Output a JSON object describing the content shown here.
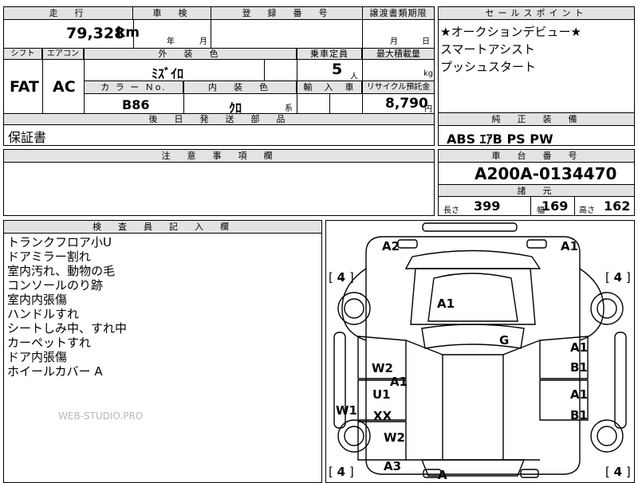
{
  "top_table": {
    "mileage_label": "走　行",
    "mileage_value": "79,328",
    "mileage_unit": "km",
    "inspection_label": "車　検",
    "inspection_year": "年",
    "inspection_month": "月",
    "registration_label": "登　録　番　号",
    "transfer_label": "譲渡書類期限",
    "transfer_month": "月",
    "transfer_day": "日",
    "shift_label": "シフト",
    "aircon_label": "エアコン",
    "exterior_color_label": "外　装　色",
    "seats_label": "乗車定員",
    "max_load_label": "最大積載量",
    "shift_value": "FAT",
    "aircon_value": "AC",
    "exterior_color_value": "ﾐｽﾞｲﾛ",
    "seats_value": "5",
    "seats_unit": "人",
    "max_load_unit": "kg",
    "color_no_label": "カ ラ ー Ｎo.",
    "interior_color_label": "内　装　色",
    "import_label": "輸　入　車",
    "recycle_label": "リサイクル預託金",
    "color_no_value": "B86",
    "interior_color_value": "ｸﾛ",
    "interior_color_suffix": "系",
    "recycle_value": "8,790",
    "recycle_unit": "円",
    "later_parts_label": "後　日　発　送　部　品",
    "later_parts_value": "保証書"
  },
  "sales_points": {
    "label": "セールスポイント",
    "lines": [
      "★オークションデビュー★",
      "スマートアシスト",
      "プッシュスタート"
    ]
  },
  "standard_equipment": {
    "label": "純　正　装　備",
    "value": "ABS ｴｱB PS PW"
  },
  "notes": {
    "label": "注　意　事　項　欄"
  },
  "chassis": {
    "label": "車　台　番　号",
    "value": "A200A-0134470",
    "specs_label": "諸　元",
    "length_label": "長さ",
    "length_value": "399",
    "width_label": "幅",
    "width_value": "169",
    "height_label": "高さ",
    "height_value": "162"
  },
  "inspector": {
    "label": "検　査　員　記　入　欄",
    "lines": [
      "トランクフロア小U",
      "ドアミラー割れ",
      "室内汚れ、動物の毛",
      "コンソールのり跡",
      "室内内張傷",
      "ハンドルすれ",
      "シートしみ中、すれ中",
      "カーペットすれ",
      "ドア内張傷",
      "ホイールカバー A"
    ],
    "watermark": "WEB-STUDIO.PRO"
  },
  "car_diagram": {
    "marks": {
      "a2_top_left": "A2",
      "a1_top_right": "A1",
      "a1_roof": "A1",
      "g_windshield": "G",
      "a1_right_front_door": "A1",
      "b1_right_front_door": "B1",
      "w2_left_front_door": "W2",
      "a1_pillar": "A1",
      "u1_left_rear_door": "U1",
      "xx_left_rear_door": "XX",
      "a1_right_rear_door": "A1",
      "b1_right_rear_door": "B1",
      "w1_left_side": "W1",
      "w2_left_rear": "W2",
      "a3_bottom": "A3",
      "a_bottom": "A"
    },
    "tire_depths": [
      "4",
      "4",
      "4",
      "4"
    ]
  }
}
